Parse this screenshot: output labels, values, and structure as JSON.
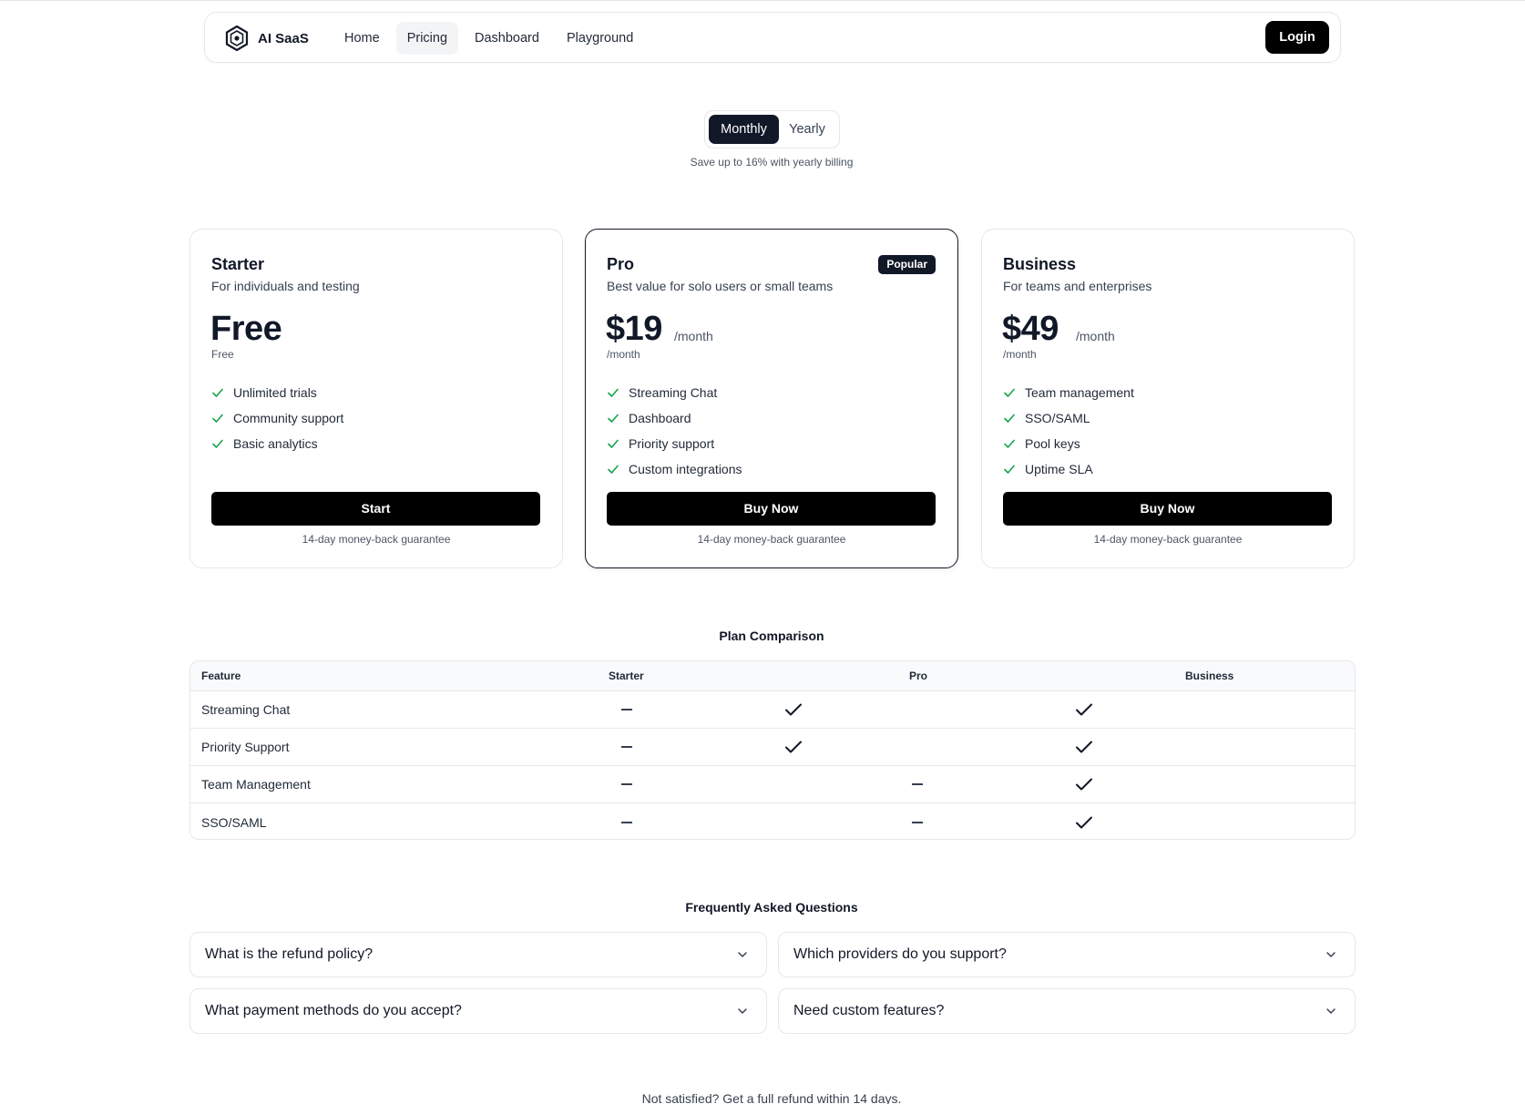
{
  "nav": {
    "brand": "AI SaaS",
    "brand_icon": "hexagon-logo-icon",
    "links": [
      {
        "label": "Home",
        "active": false
      },
      {
        "label": "Pricing",
        "active": true
      },
      {
        "label": "Dashboard",
        "active": false
      },
      {
        "label": "Playground",
        "active": false
      }
    ],
    "login_label": "Login"
  },
  "billing": {
    "options": [
      "Monthly",
      "Yearly"
    ],
    "selected": "Monthly",
    "note": "Save up to 16% with yearly billing"
  },
  "plans": [
    {
      "name": "Starter",
      "description": "For individuals and testing",
      "price": "Free",
      "period": "",
      "subtext": "Free",
      "features": [
        "Unlimited trials",
        "Community support",
        "Basic analytics"
      ],
      "cta": "Start",
      "guarantee": "14-day money-back guarantee"
    },
    {
      "name": "Pro",
      "description": "Best value for solo users or small teams",
      "badge": "Popular",
      "price": "$19",
      "period": "/month",
      "subtext": "/month",
      "features": [
        "Streaming Chat",
        "Dashboard",
        "Priority support",
        "Custom integrations"
      ],
      "cta": "Buy Now",
      "guarantee": "14-day money-back guarantee"
    },
    {
      "name": "Business",
      "description": "For teams and enterprises",
      "price": "$49",
      "period": "/month",
      "subtext": "/month",
      "features": [
        "Team management",
        "SSO/SAML",
        "Pool keys",
        "Uptime SLA"
      ],
      "cta": "Buy Now",
      "guarantee": "14-day money-back guarantee"
    }
  ],
  "comparison": {
    "title": "Plan Comparison",
    "headers": [
      "Feature",
      "Starter",
      "Pro",
      "Business"
    ],
    "rows": [
      {
        "feature": "Streaming Chat",
        "starter": false,
        "pro": true,
        "business": true
      },
      {
        "feature": "Priority Support",
        "starter": false,
        "pro": true,
        "business": true
      },
      {
        "feature": "Team Management",
        "starter": false,
        "pro": false,
        "business": true
      },
      {
        "feature": "SSO/SAML",
        "starter": false,
        "pro": false,
        "business": true
      }
    ]
  },
  "faq": {
    "title": "Frequently Asked Questions",
    "items": [
      "What is the refund policy?",
      "Which providers do you support?",
      "What payment methods do you accept?",
      "Need custom features?"
    ]
  },
  "footer_note": "Not satisfied? Get a full refund within 14 days.",
  "colors": {
    "check": "#16a34a",
    "primary": "#111827",
    "border": "#e5e7eb"
  }
}
